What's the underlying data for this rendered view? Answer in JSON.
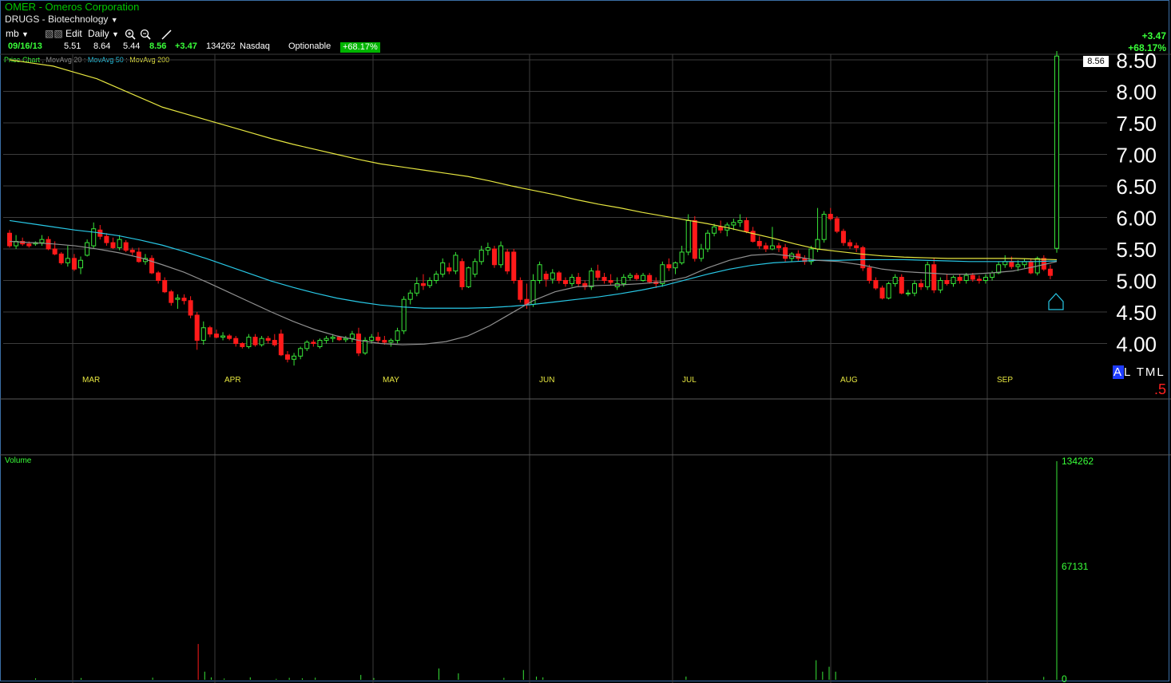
{
  "header": {
    "ticker_title": "OMER - Omeros Corporation",
    "sector": "DRUGS - Biotechnology"
  },
  "toolbar": {
    "layout": "mb",
    "edit": "Edit",
    "period": "Daily"
  },
  "quote": {
    "date": "09/16/13",
    "open": "5.51",
    "high": "8.64",
    "low": "5.44",
    "close": "8.56",
    "change": "+3.47",
    "volume": "134262",
    "exchange": "Nasdaq",
    "optionable": "Optionable",
    "pct_change": "+68.17%"
  },
  "right_header": {
    "change": "+3.47",
    "pct_change": "+68.17%"
  },
  "legend": {
    "price_chart": "Price Chart",
    "ma20": "MovAvg 20",
    "ma50": "MovAvg 50",
    "ma200": "MovAvg 200"
  },
  "price_tag": "8.56",
  "al_tml": {
    "a": "A",
    "rest": "L TML"
  },
  "five": ".5",
  "volume_label": "Volume",
  "colors": {
    "up": "#39e639",
    "down": "#ff1a1a",
    "ma20": "#909090",
    "ma50": "#28c8e6",
    "ma200": "#e6e640",
    "axis_month": "#e6e640",
    "grid": "#3c3c3c"
  },
  "chart_data": {
    "type": "candlestick",
    "y_ticks": [
      "8.50",
      "8.00",
      "7.50",
      "7.00",
      "6.50",
      "6.00",
      "5.50",
      "5.00",
      "4.50",
      "4.00"
    ],
    "ylim": [
      3.6,
      8.6
    ],
    "x_months": [
      "MAR",
      "APR",
      "MAY",
      "JUN",
      "JUL",
      "AUG",
      "SEP"
    ],
    "candles": [
      [
        5.75,
        5.8,
        5.52,
        5.55
      ],
      [
        5.55,
        5.72,
        5.5,
        5.62
      ],
      [
        5.62,
        5.68,
        5.55,
        5.58
      ],
      [
        5.58,
        5.62,
        5.52,
        5.55
      ],
      [
        5.58,
        5.62,
        5.55,
        5.6
      ],
      [
        5.6,
        5.72,
        5.55,
        5.65
      ],
      [
        5.65,
        5.7,
        5.48,
        5.5
      ],
      [
        5.5,
        5.62,
        5.4,
        5.42
      ],
      [
        5.42,
        5.45,
        5.25,
        5.28
      ],
      [
        5.28,
        5.55,
        5.22,
        5.35
      ],
      [
        5.35,
        5.42,
        5.15,
        5.18
      ],
      [
        5.2,
        5.38,
        5.1,
        5.32
      ],
      [
        5.4,
        5.65,
        5.38,
        5.6
      ],
      [
        5.55,
        5.92,
        5.5,
        5.82
      ],
      [
        5.8,
        5.88,
        5.65,
        5.7
      ],
      [
        5.7,
        5.75,
        5.55,
        5.6
      ],
      [
        5.6,
        5.68,
        5.5,
        5.52
      ],
      [
        5.52,
        5.72,
        5.48,
        5.65
      ],
      [
        5.6,
        5.64,
        5.45,
        5.48
      ],
      [
        5.48,
        5.52,
        5.4,
        5.45
      ],
      [
        5.45,
        5.52,
        5.28,
        5.3
      ],
      [
        5.3,
        5.42,
        5.25,
        5.35
      ],
      [
        5.35,
        5.4,
        5.1,
        5.12
      ],
      [
        5.12,
        5.15,
        4.95,
        5.0
      ],
      [
        5.0,
        5.05,
        4.8,
        4.82
      ],
      [
        4.82,
        4.85,
        4.6,
        4.65
      ],
      [
        4.7,
        4.78,
        4.55,
        4.72
      ],
      [
        4.72,
        4.78,
        4.62,
        4.68
      ],
      [
        4.68,
        4.75,
        4.4,
        4.45
      ],
      [
        4.45,
        4.5,
        3.9,
        4.05
      ],
      [
        4.05,
        4.35,
        3.98,
        4.25
      ],
      [
        4.25,
        4.28,
        4.1,
        4.15
      ],
      [
        4.15,
        4.22,
        4.08,
        4.1
      ],
      [
        4.1,
        4.18,
        4.05,
        4.12
      ],
      [
        4.12,
        4.15,
        4.05,
        4.08
      ],
      [
        4.08,
        4.12,
        3.95,
        4.0
      ],
      [
        4.0,
        4.02,
        3.92,
        3.95
      ],
      [
        3.95,
        4.15,
        3.92,
        4.1
      ],
      [
        4.1,
        4.15,
        3.95,
        3.98
      ],
      [
        3.98,
        4.12,
        3.95,
        4.08
      ],
      [
        4.08,
        4.12,
        4.0,
        4.05
      ],
      [
        4.05,
        4.15,
        3.95,
        3.98
      ],
      [
        4.15,
        4.22,
        3.8,
        3.82
      ],
      [
        3.82,
        3.88,
        3.7,
        3.75
      ],
      [
        3.75,
        3.85,
        3.65,
        3.8
      ],
      [
        3.8,
        3.95,
        3.75,
        3.92
      ],
      [
        3.92,
        4.05,
        3.88,
        4.02
      ],
      [
        4.02,
        4.06,
        3.95,
        4.0
      ],
      [
        3.95,
        4.08,
        3.92,
        4.05
      ],
      [
        4.05,
        4.12,
        4.0,
        4.08
      ],
      [
        4.08,
        4.15,
        4.02,
        4.1
      ],
      [
        4.1,
        4.12,
        4.04,
        4.06
      ],
      [
        4.06,
        4.12,
        4.02,
        4.08
      ],
      [
        4.08,
        4.2,
        4.02,
        4.15
      ],
      [
        4.15,
        4.25,
        3.8,
        3.85
      ],
      [
        3.85,
        4.1,
        3.82,
        4.05
      ],
      [
        4.05,
        4.15,
        4.0,
        4.1
      ],
      [
        4.1,
        4.18,
        4.0,
        4.05
      ],
      [
        4.05,
        4.12,
        3.98,
        4.02
      ],
      [
        4.02,
        4.08,
        3.95,
        4.05
      ],
      [
        4.05,
        4.25,
        4.0,
        4.2
      ],
      [
        4.2,
        4.75,
        4.15,
        4.7
      ],
      [
        4.7,
        4.85,
        4.62,
        4.8
      ],
      [
        4.8,
        5.05,
        4.75,
        4.95
      ],
      [
        4.95,
        5.1,
        4.85,
        4.92
      ],
      [
        4.92,
        5.05,
        4.88,
        5.0
      ],
      [
        5.0,
        5.15,
        4.95,
        5.1
      ],
      [
        5.1,
        5.35,
        5.05,
        5.28
      ],
      [
        5.2,
        5.28,
        5.1,
        5.15
      ],
      [
        5.15,
        5.45,
        5.1,
        5.4
      ],
      [
        5.3,
        5.35,
        4.85,
        4.9
      ],
      [
        4.9,
        5.22,
        4.88,
        5.2
      ],
      [
        5.1,
        5.35,
        5.05,
        5.3
      ],
      [
        5.3,
        5.55,
        5.25,
        5.48
      ],
      [
        5.48,
        5.6,
        5.4,
        5.52
      ],
      [
        5.5,
        5.55,
        5.2,
        5.25
      ],
      [
        5.25,
        5.62,
        5.2,
        5.55
      ],
      [
        5.45,
        5.5,
        5.1,
        5.15
      ],
      [
        5.45,
        5.5,
        4.95,
        5.0
      ],
      [
        5.0,
        5.05,
        4.65,
        4.7
      ],
      [
        4.7,
        4.95,
        4.55,
        4.62
      ],
      [
        4.62,
        5.1,
        4.58,
        5.0
      ],
      [
        5.0,
        5.3,
        4.95,
        5.25
      ],
      [
        5.1,
        5.15,
        4.9,
        5.02
      ],
      [
        5.02,
        5.18,
        4.95,
        5.12
      ],
      [
        5.12,
        5.15,
        4.95,
        5.0
      ],
      [
        5.0,
        5.05,
        4.9,
        4.95
      ],
      [
        4.95,
        5.1,
        4.9,
        5.05
      ],
      [
        5.05,
        5.12,
        4.9,
        4.95
      ],
      [
        4.95,
        5.0,
        4.85,
        4.9
      ],
      [
        4.9,
        5.2,
        4.85,
        5.15
      ],
      [
        5.15,
        5.25,
        5.0,
        5.05
      ],
      [
        5.05,
        5.12,
        4.95,
        5.0
      ],
      [
        5.0,
        5.1,
        4.92,
        4.97
      ],
      [
        4.9,
        5.05,
        4.85,
        4.95
      ],
      [
        4.95,
        5.1,
        4.9,
        5.05
      ],
      [
        5.05,
        5.12,
        5.0,
        5.08
      ],
      [
        5.08,
        5.12,
        5.0,
        5.03
      ],
      [
        5.0,
        5.12,
        4.98,
        5.08
      ],
      [
        5.08,
        5.12,
        4.95,
        4.98
      ],
      [
        4.98,
        5.05,
        4.88,
        4.95
      ],
      [
        4.95,
        5.3,
        4.9,
        5.25
      ],
      [
        5.25,
        5.35,
        5.15,
        5.2
      ],
      [
        5.2,
        5.3,
        5.1,
        5.28
      ],
      [
        5.28,
        5.55,
        5.25,
        5.45
      ],
      [
        5.45,
        6.05,
        5.4,
        5.95
      ],
      [
        5.95,
        6.02,
        5.3,
        5.35
      ],
      [
        5.35,
        5.58,
        5.3,
        5.5
      ],
      [
        5.5,
        5.8,
        5.45,
        5.75
      ],
      [
        5.75,
        5.9,
        5.7,
        5.85
      ],
      [
        5.85,
        5.95,
        5.75,
        5.8
      ],
      [
        5.8,
        5.92,
        5.7,
        5.88
      ],
      [
        5.88,
        5.98,
        5.8,
        5.92
      ],
      [
        5.92,
        6.05,
        5.85,
        5.95
      ],
      [
        5.95,
        6.0,
        5.75,
        5.78
      ],
      [
        5.78,
        5.85,
        5.6,
        5.62
      ],
      [
        5.62,
        5.7,
        5.5,
        5.55
      ],
      [
        5.55,
        5.6,
        5.45,
        5.5
      ],
      [
        5.5,
        5.85,
        5.48,
        5.55
      ],
      [
        5.55,
        5.6,
        5.45,
        5.52
      ],
      [
        5.52,
        5.58,
        5.3,
        5.35
      ],
      [
        5.35,
        5.45,
        5.3,
        5.42
      ],
      [
        5.42,
        5.48,
        5.3,
        5.35
      ],
      [
        5.35,
        5.4,
        5.25,
        5.3
      ],
      [
        5.3,
        5.55,
        5.25,
        5.5
      ],
      [
        5.5,
        6.15,
        5.45,
        5.65
      ],
      [
        5.65,
        6.1,
        5.6,
        6.05
      ],
      [
        6.05,
        6.15,
        5.95,
        5.98
      ],
      [
        5.98,
        6.02,
        5.75,
        5.78
      ],
      [
        5.78,
        5.82,
        5.55,
        5.6
      ],
      [
        5.6,
        5.65,
        5.5,
        5.55
      ],
      [
        5.55,
        5.6,
        5.45,
        5.52
      ],
      [
        5.52,
        5.55,
        5.15,
        5.2
      ],
      [
        5.2,
        5.25,
        4.95,
        5.0
      ],
      [
        5.0,
        5.05,
        4.85,
        4.88
      ],
      [
        4.88,
        4.92,
        4.7,
        4.72
      ],
      [
        4.72,
        4.98,
        4.7,
        4.95
      ],
      [
        4.95,
        5.1,
        4.9,
        5.05
      ],
      [
        5.05,
        5.1,
        4.78,
        4.8
      ],
      [
        4.8,
        4.85,
        4.75,
        4.8
      ],
      [
        4.8,
        5.0,
        4.75,
        4.95
      ],
      [
        4.95,
        5.02,
        4.85,
        4.9
      ],
      [
        4.9,
        5.3,
        4.85,
        5.25
      ],
      [
        5.25,
        5.35,
        4.8,
        4.85
      ],
      [
        4.85,
        5.05,
        4.8,
        5.0
      ],
      [
        5.0,
        5.1,
        4.92,
        4.95
      ],
      [
        4.95,
        5.08,
        4.9,
        5.05
      ],
      [
        5.05,
        5.1,
        4.95,
        5.0
      ],
      [
        5.0,
        5.12,
        4.95,
        5.08
      ],
      [
        5.08,
        5.12,
        4.98,
        5.02
      ],
      [
        5.02,
        5.08,
        4.95,
        5.0
      ],
      [
        5.0,
        5.1,
        4.95,
        5.05
      ],
      [
        5.05,
        5.15,
        5.0,
        5.12
      ],
      [
        5.12,
        5.3,
        5.1,
        5.25
      ],
      [
        5.25,
        5.4,
        5.2,
        5.3
      ],
      [
        5.3,
        5.38,
        5.18,
        5.22
      ],
      [
        5.22,
        5.32,
        5.15,
        5.25
      ],
      [
        5.25,
        5.35,
        5.2,
        5.3
      ],
      [
        5.3,
        5.35,
        5.1,
        5.12
      ],
      [
        5.12,
        5.38,
        5.08,
        5.35
      ],
      [
        5.35,
        5.4,
        5.15,
        5.18
      ],
      [
        5.18,
        5.25,
        5.02,
        5.08
      ],
      [
        5.51,
        8.64,
        5.44,
        8.56
      ]
    ],
    "ma20": [
      5.62,
      5.6,
      5.58,
      5.55,
      5.5,
      5.44,
      5.36,
      5.25,
      5.13,
      4.98,
      4.82,
      4.66,
      4.5,
      4.35,
      4.22,
      4.12,
      4.05,
      4.0,
      3.98,
      3.99,
      4.03,
      4.12,
      4.28,
      4.48,
      4.68,
      4.82,
      4.9,
      4.92,
      4.93,
      4.95,
      4.98,
      5.05,
      5.2,
      5.32,
      5.4,
      5.42,
      5.38,
      5.32,
      5.3,
      5.25,
      5.18,
      5.14,
      5.12,
      5.1,
      5.1,
      5.12,
      5.15,
      5.22,
      5.3
    ],
    "ma50": [
      5.95,
      5.9,
      5.85,
      5.8,
      5.76,
      5.71,
      5.64,
      5.56,
      5.46,
      5.35,
      5.23,
      5.11,
      4.99,
      4.89,
      4.8,
      4.72,
      4.66,
      4.61,
      4.58,
      4.56,
      4.56,
      4.56,
      4.57,
      4.59,
      4.62,
      4.66,
      4.7,
      4.74,
      4.79,
      4.85,
      4.92,
      5.01,
      5.1,
      5.18,
      5.24,
      5.28,
      5.3,
      5.32,
      5.32,
      5.33,
      5.33,
      5.33,
      5.32,
      5.31,
      5.3,
      5.3,
      5.3,
      5.3,
      5.31
    ],
    "ma200": [
      8.5,
      8.45,
      8.4,
      8.3,
      8.2,
      8.05,
      7.9,
      7.75,
      7.65,
      7.55,
      7.45,
      7.35,
      7.25,
      7.16,
      7.08,
      7.0,
      6.92,
      6.85,
      6.8,
      6.75,
      6.7,
      6.65,
      6.58,
      6.5,
      6.43,
      6.36,
      6.28,
      6.21,
      6.15,
      6.08,
      6.02,
      5.96,
      5.9,
      5.83,
      5.75,
      5.67,
      5.58,
      5.5,
      5.46,
      5.42,
      5.39,
      5.37,
      5.36,
      5.35,
      5.35,
      5.35,
      5.35,
      5.34,
      5.33
    ],
    "volume_scale": {
      "max": "134262",
      "mid": "67131",
      "min": "0"
    },
    "volume_values": [
      0,
      0,
      0,
      0,
      900,
      0,
      0,
      0,
      0,
      0,
      0,
      1100,
      0,
      0,
      0,
      0,
      0,
      0,
      0,
      0,
      0,
      0,
      1300,
      0,
      0,
      0,
      0,
      0,
      0,
      22000,
      5000,
      1500,
      0,
      800,
      0,
      0,
      0,
      1500,
      0,
      0,
      0,
      600,
      0,
      1200,
      0,
      900,
      0,
      1300,
      0,
      0,
      0,
      0,
      0,
      0,
      3000,
      0,
      1100,
      0,
      0,
      0,
      0,
      0,
      0,
      0,
      0,
      0,
      7000,
      0,
      0,
      4000,
      0,
      0,
      0,
      0,
      0,
      0,
      1200,
      0,
      0,
      6000,
      0,
      2000,
      1500,
      0,
      0,
      0,
      0,
      0,
      0,
      0,
      0,
      0,
      0,
      0,
      0,
      0,
      0,
      0,
      0,
      0,
      0,
      0,
      0,
      0,
      2000,
      0,
      0,
      0,
      0,
      0,
      0,
      0,
      0,
      0,
      0,
      0,
      0,
      0,
      0,
      0,
      0,
      0,
      0,
      0,
      12000,
      5000,
      8000,
      5000,
      0,
      0,
      0,
      0,
      0,
      0,
      0,
      0,
      0,
      0,
      0,
      0,
      0,
      0,
      0,
      0,
      0,
      0,
      0,
      0,
      0,
      0,
      0,
      0,
      0,
      0,
      0,
      0,
      0,
      0,
      0,
      1800,
      0,
      134262
    ]
  }
}
